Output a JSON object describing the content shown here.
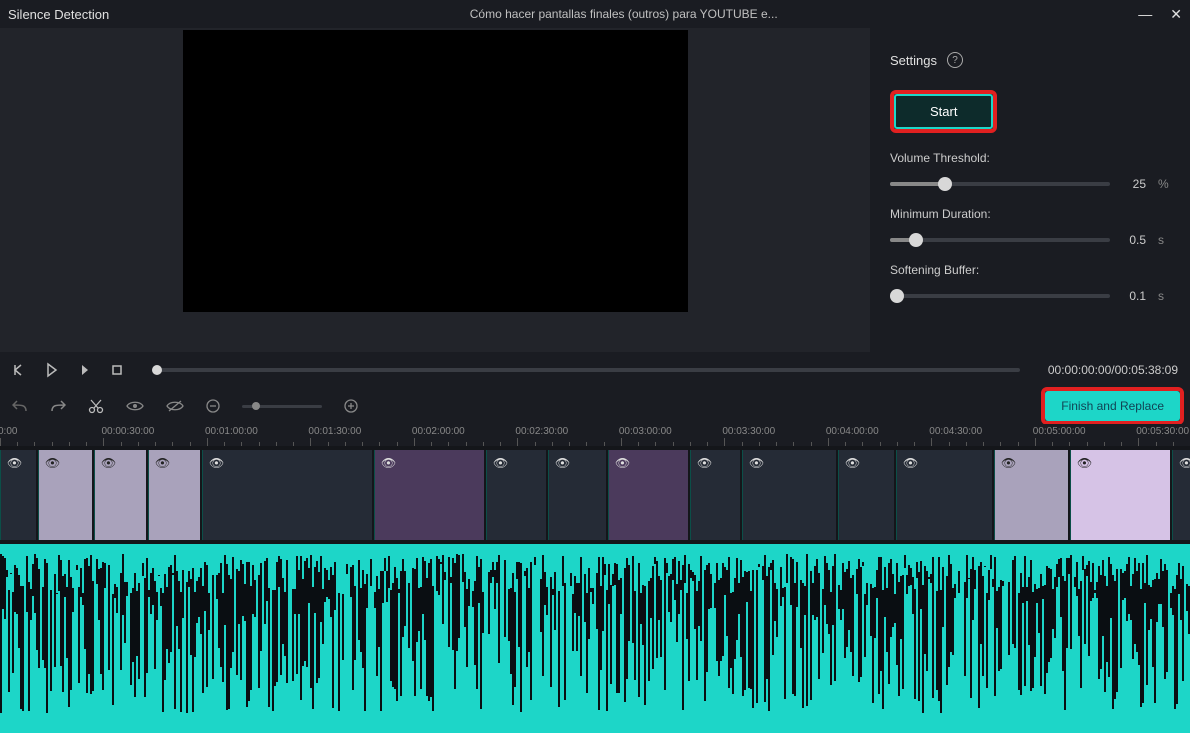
{
  "titlebar": {
    "title": "Silence Detection",
    "filename": "Cómo hacer pantallas finales (outros) para YOUTUBE e..."
  },
  "settings": {
    "header": "Settings",
    "start": "Start",
    "volume_threshold_label": "Volume Threshold:",
    "volume_threshold_value": "25",
    "volume_threshold_unit": "%",
    "volume_threshold_pct": 25,
    "min_duration_label": "Minimum Duration:",
    "min_duration_value": "0.5",
    "min_duration_unit": "s",
    "min_duration_pct": 12,
    "soft_buffer_label": "Softening Buffer:",
    "soft_buffer_value": "0.1",
    "soft_buffer_unit": "s",
    "soft_buffer_pct": 3
  },
  "playback": {
    "time": "00:00:00:00/00:05:38:09"
  },
  "toolbar": {
    "finish": "Finish and Replace"
  },
  "ruler": {
    "marks": [
      "0:00",
      "00:00:30:00",
      "00:01:00:00",
      "00:01:30:00",
      "00:02:00:00",
      "00:02:30:00",
      "00:03:00:00",
      "00:03:30:00",
      "00:04:00:00",
      "00:04:30:00",
      "00:05:00:00",
      "00:05:30:00"
    ]
  }
}
